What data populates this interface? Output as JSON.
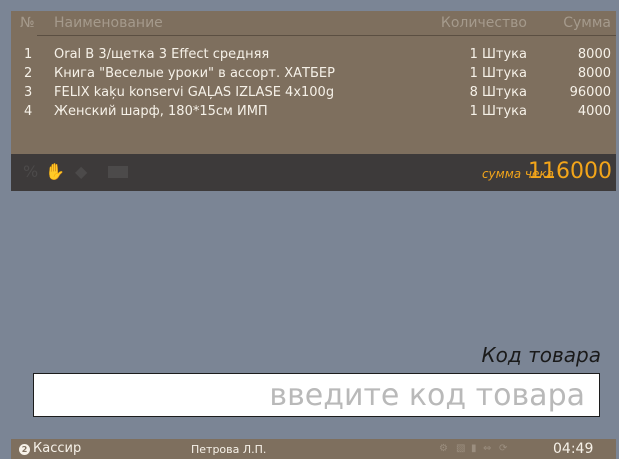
{
  "table": {
    "columns": {
      "num": "№",
      "name": "Наименование",
      "qty": "Количество",
      "sum": "Сумма"
    },
    "rows": [
      {
        "num": "1",
        "name": "Oral B 3/щетка 3 Effect средняя",
        "qty": "1 Штука",
        "sum": "8000"
      },
      {
        "num": "2",
        "name": "Книга \"Веселые уроки\" в ассорт. ХАТБЕР",
        "qty": "1 Штука",
        "sum": "8000"
      },
      {
        "num": "3",
        "name": "FELIX kaķu konservi GAĻAS IZLASE 4x100g",
        "qty": "8 Штука",
        "sum": "96000"
      },
      {
        "num": "4",
        "name": "Женский шарф, 180*15см ИМП",
        "qty": "1 Штука",
        "sum": "4000"
      }
    ]
  },
  "toolbar": {
    "icons": [
      "percent-icon",
      "hand-icon",
      "card-icon",
      "keyboard-icon"
    ],
    "total_label": "сумма чека",
    "total_value": "116000"
  },
  "code": {
    "label": "Код товара",
    "placeholder": "введите код товара",
    "value": ""
  },
  "status": {
    "role_badge": "2",
    "role": "Кассир",
    "cashier": "Петрова Л.П.",
    "clock": "04:49"
  },
  "colors": {
    "accent": "#f3a51a",
    "panel": "#7e6f5e",
    "toolbar": "#3d3a3a",
    "background": "#7b8595"
  }
}
